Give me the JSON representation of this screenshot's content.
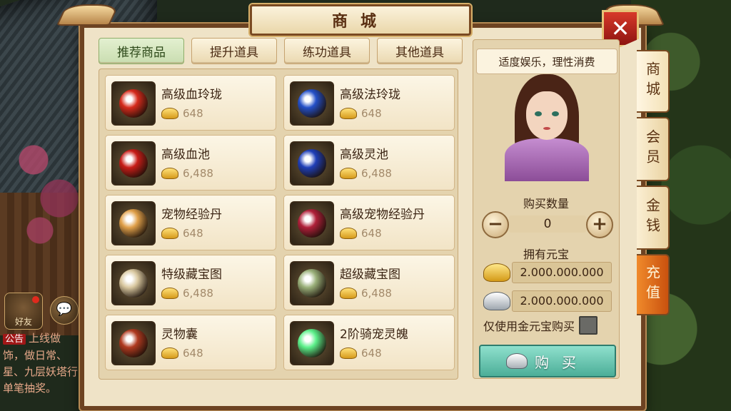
{
  "window": {
    "title": "商城",
    "close_glyph": "✕"
  },
  "tabs": [
    {
      "label": "推荐商品",
      "active": true
    },
    {
      "label": "提升道具",
      "active": false
    },
    {
      "label": "练功道具",
      "active": false
    },
    {
      "label": "其他道具",
      "active": false
    }
  ],
  "items": [
    {
      "name": "高级血玲珑",
      "price": "648",
      "icon": "red-orb-icon",
      "color": "#d62b1c"
    },
    {
      "name": "高级法玲珑",
      "price": "648",
      "icon": "blue-orb-icon",
      "color": "#2450c8"
    },
    {
      "name": "高级血池",
      "price": "6,488",
      "icon": "red-pool-orb-icon",
      "color": "#c81d18"
    },
    {
      "name": "高级灵池",
      "price": "6,488",
      "icon": "blue-pool-orb-icon",
      "color": "#1f3fb8"
    },
    {
      "name": "宠物经验丹",
      "price": "648",
      "icon": "golden-pills-icon",
      "color": "#e0a04a"
    },
    {
      "name": "高级宠物经验丹",
      "price": "648",
      "icon": "red-pills-icon",
      "color": "#b0203a"
    },
    {
      "name": "特级藏宝图",
      "price": "6,488",
      "icon": "scroll-map-icon",
      "color": "#d9c8a0"
    },
    {
      "name": "超级藏宝图",
      "price": "6,488",
      "icon": "framed-map-icon",
      "color": "#9ab07a"
    },
    {
      "name": "灵物囊",
      "price": "648",
      "icon": "pouch-icon",
      "color": "#b03a20"
    },
    {
      "name": "2阶骑宠灵魄",
      "price": "648",
      "icon": "green-spirit-orb-icon",
      "color": "#5cf08a"
    }
  ],
  "side": {
    "slogan": "适度娱乐，理性消费",
    "qty_label": "购买数量",
    "qty_value": "0",
    "minus_glyph": "−",
    "plus_glyph": "+",
    "own_label": "拥有元宝",
    "gold_balance": "2.000.000.000",
    "silver_balance": "2.000.000.000",
    "only_gold_label": "仅使用金元宝购买",
    "buy_label": "购买"
  },
  "vtabs": [
    {
      "label": "商城",
      "active": true
    },
    {
      "label": "会员",
      "active": false
    },
    {
      "label": "金钱",
      "active": false
    },
    {
      "label": "充值",
      "active": false
    }
  ],
  "hud": {
    "friends_label": "好友",
    "announce_tag": "公告",
    "announce_text": "上线做饰，做日常、星、九层妖塔行单笔抽奖。"
  }
}
